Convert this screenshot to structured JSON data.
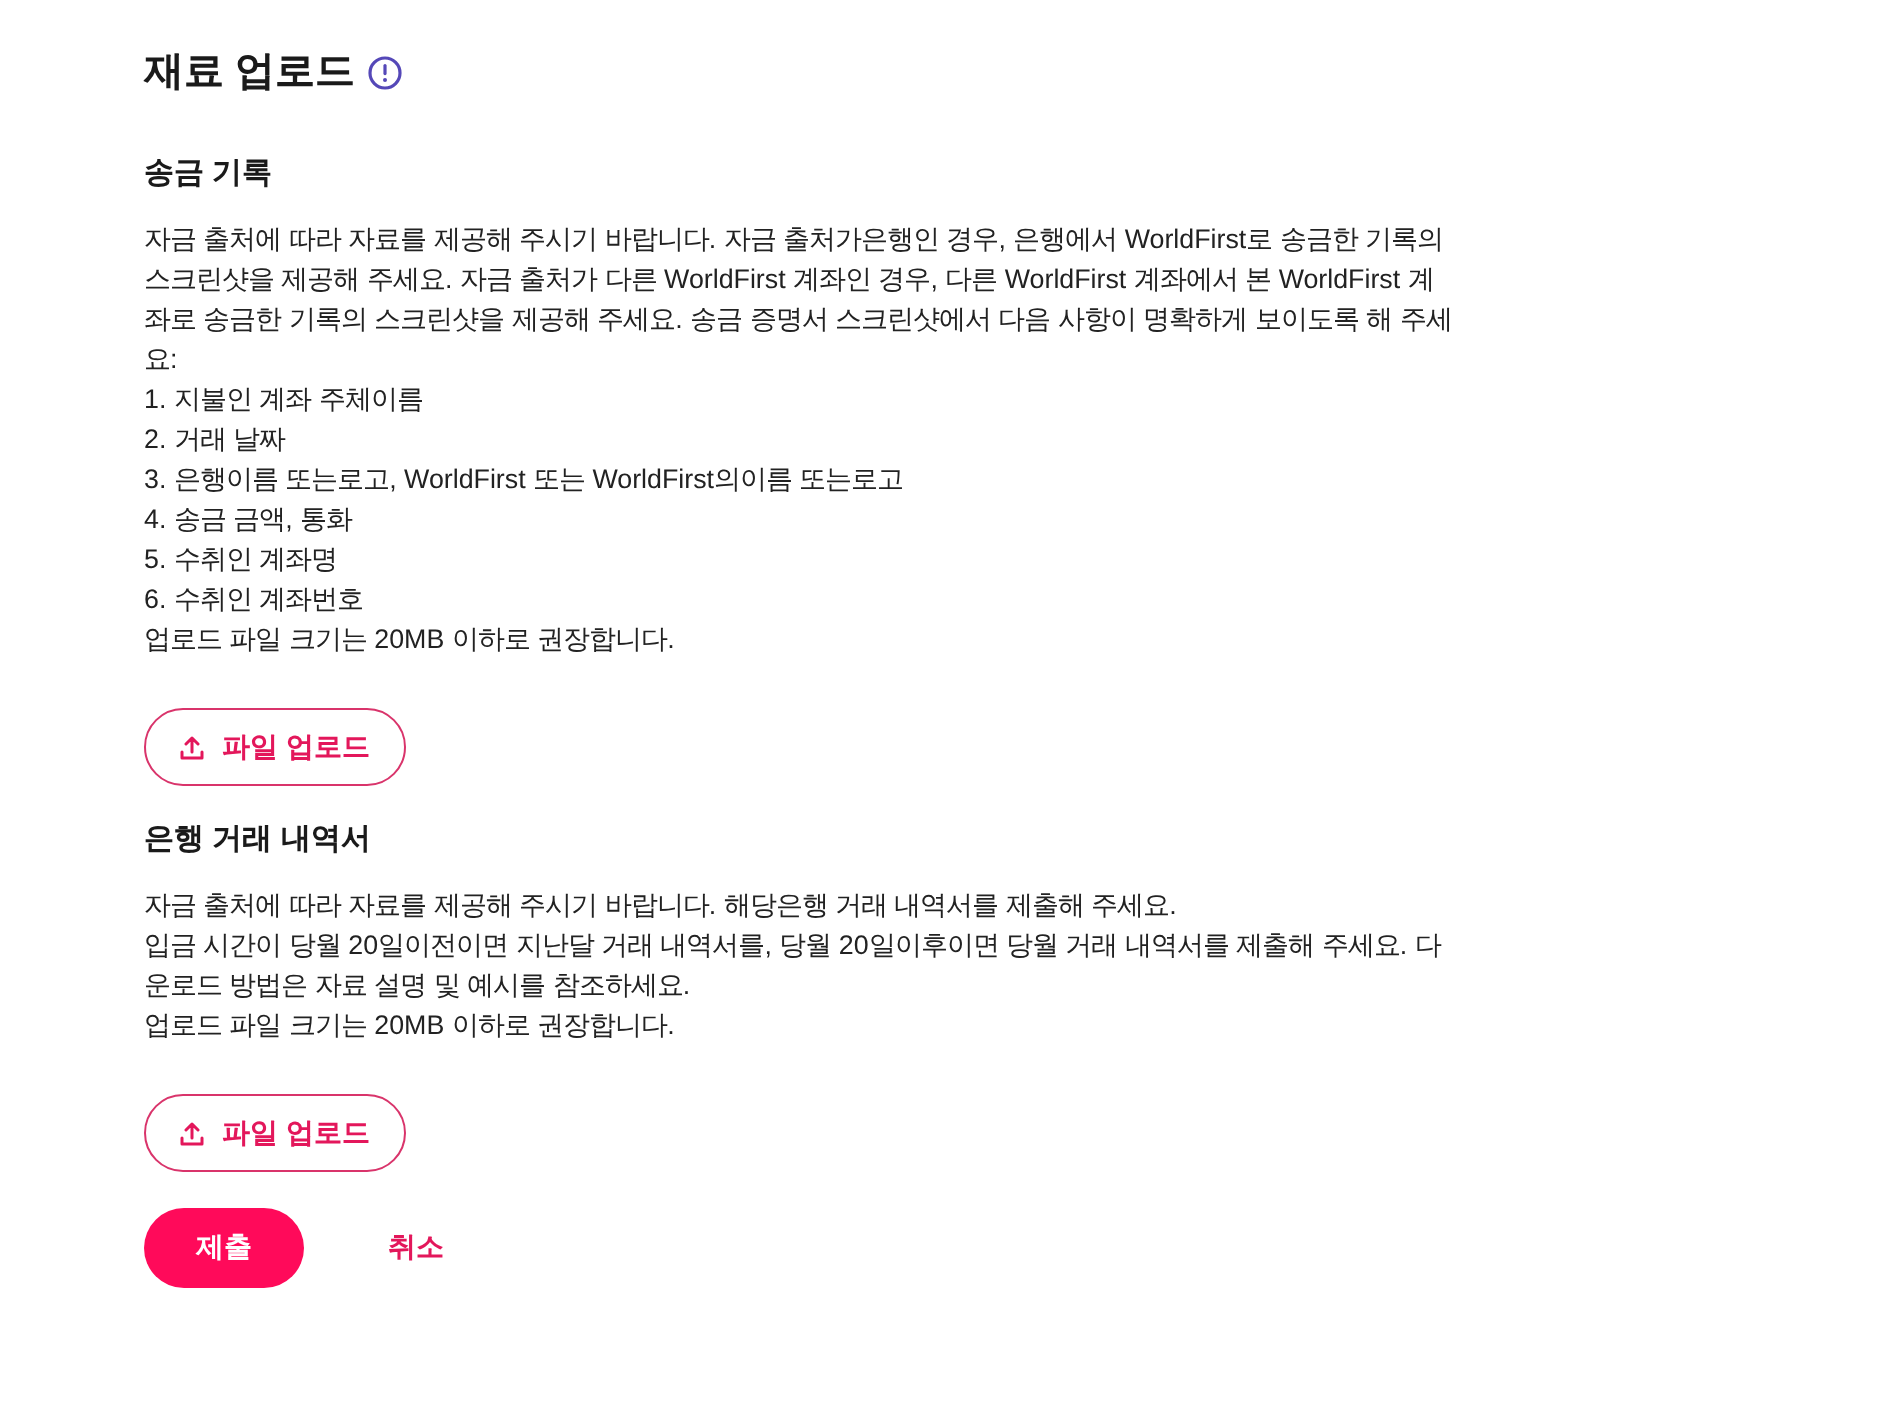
{
  "page": {
    "title": "재료 업로드"
  },
  "sections": [
    {
      "heading": "송금 기록",
      "lines": [
        "자금 출처에 따라 자료를 제공해 주시기 바랍니다. 자금 출처가은행인 경우, 은행에서 WorldFirst로 송금한 기록의 스크린샷을 제공해 주세요. 자금 출처가 다른 WorldFirst 계좌인 경우, 다른 WorldFirst 계좌에서 본 WorldFirst 계좌로 송금한 기록의 스크린샷을 제공해 주세요. 송금 증명서 스크린샷에서 다음 사항이 명확하게 보이도록 해 주세요:",
        "1. 지불인 계좌 주체이름",
        "2. 거래 날짜",
        "3. 은행이름 또는로고, WorldFirst 또는 WorldFirst의이름 또는로고",
        "4. 송금 금액, 통화",
        "5. 수취인 계좌명",
        "6. 수취인 계좌번호",
        "업로드 파일 크기는 20MB 이하로 권장합니다."
      ],
      "upload_button": "파일 업로드"
    },
    {
      "heading": "은행 거래 내역서",
      "lines": [
        "자금 출처에 따라 자료를 제공해 주시기 바랍니다. 해당은행 거래 내역서를 제출해 주세요.",
        "입금 시간이 당월 20일이전이면 지난달 거래 내역서를, 당월 20일이후이면 당월 거래 내역서를 제출해 주세요. 다운로드 방법은 자료 설명 및 예시를 참조하세요.",
        "업로드 파일 크기는 20MB 이하로 권장합니다."
      ],
      "upload_button": "파일 업로드"
    }
  ],
  "actions": [
    {
      "label": "제출",
      "kind": "primary"
    },
    {
      "label": "취소",
      "kind": "text"
    }
  ]
}
